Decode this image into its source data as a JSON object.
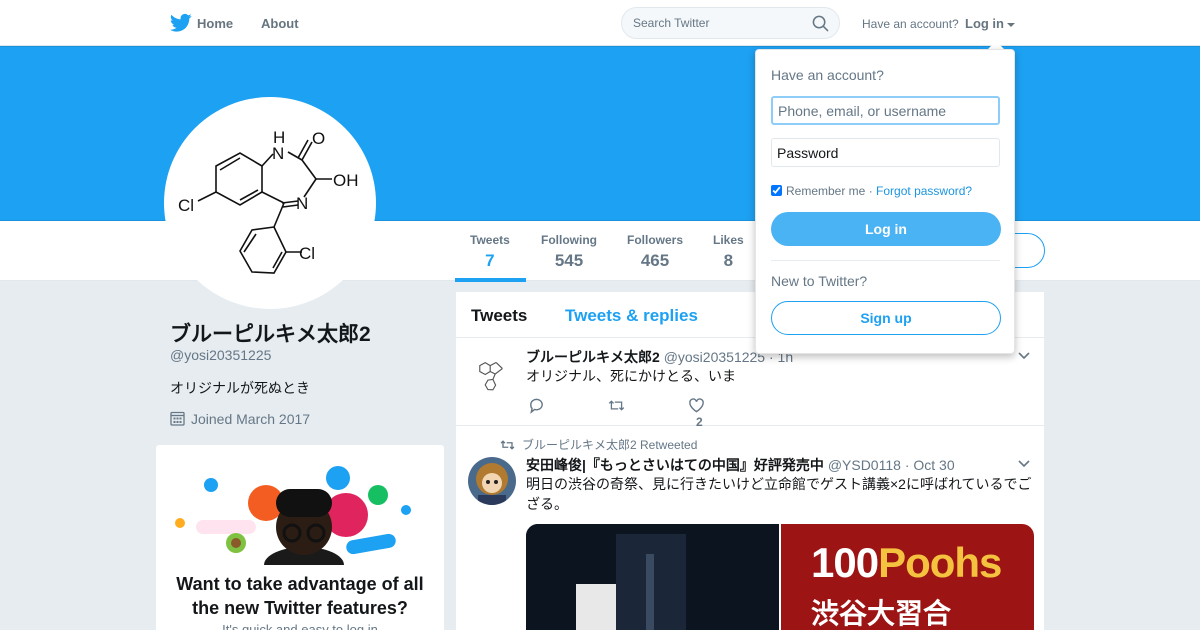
{
  "nav": {
    "home": "Home",
    "about": "About",
    "search_placeholder": "Search Twitter",
    "have_account": "Have an account?",
    "login": "Log in"
  },
  "profile": {
    "name": "ブルーピルキメ太郎2",
    "handle": "@yosi20351225",
    "bio": "オリジナルが死ぬとき",
    "joined": "Joined March 2017",
    "avatar_labels": {
      "nh": "H",
      "n1": "N",
      "o": "O",
      "oh": "OH",
      "n2": "N",
      "cl1": "Cl",
      "cl2": "Cl"
    }
  },
  "stats": [
    {
      "label": "Tweets",
      "value": "7",
      "active": true
    },
    {
      "label": "Following",
      "value": "545",
      "active": false
    },
    {
      "label": "Followers",
      "value": "465",
      "active": false
    },
    {
      "label": "Likes",
      "value": "8",
      "active": false
    }
  ],
  "promo": {
    "title": "Want to take advantage of all the new Twitter features?",
    "subtitle": "It's quick and easy to log in"
  },
  "timeline": {
    "tabs": [
      "Tweets",
      "Tweets & replies"
    ],
    "tweets": [
      {
        "name": "ブルーピルキメ太郎2",
        "handle": "@yosi20351225",
        "time": "· 1h",
        "text": "オリジナル、死にかけとる、いま",
        "likes": "2"
      },
      {
        "context": "ブルーピルキメ太郎2 Retweeted",
        "name": "安田峰俊|『もっとさいはての中国』好評発売中",
        "handle": "@YSD0118",
        "time": "· Oct 30",
        "text": "明日の渋谷の奇祭、見に行きたいけど立命館でゲスト講義×2に呼ばれているでござる。",
        "media_text1": "100",
        "media_text2": "Poohs",
        "media_text3": "渋谷大習合"
      }
    ]
  },
  "login_dropdown": {
    "title": "Have an account?",
    "username_placeholder": "Phone, email, or username",
    "password_placeholder": "Password",
    "remember": "Remember me",
    "separator": "·",
    "forgot": "Forgot password?",
    "login_button": "Log in",
    "new_to_twitter": "New to Twitter?",
    "signup_button": "Sign up"
  },
  "colors": {
    "brand": "#1da1f2",
    "text": "#14171a",
    "muted": "#657786",
    "background": "#e6ecf0"
  }
}
